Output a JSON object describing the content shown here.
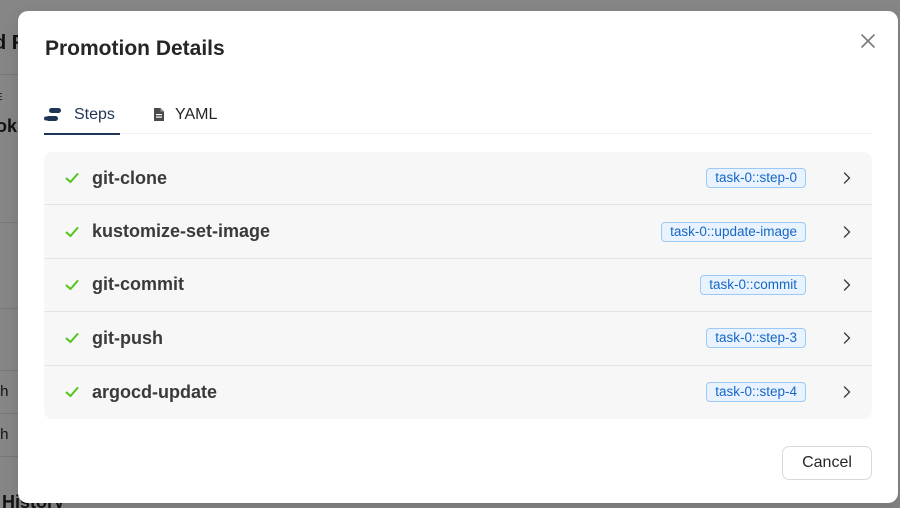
{
  "background": {
    "fragments": [
      "d F",
      "E",
      "ok",
      "th",
      "th",
      "History"
    ]
  },
  "modal": {
    "title": "Promotion Details",
    "close_icon": "close-icon"
  },
  "tabs": [
    {
      "label": "Steps",
      "icon": "steps-icon",
      "active": true
    },
    {
      "label": "YAML",
      "icon": "file-icon",
      "active": false
    }
  ],
  "steps": [
    {
      "name": "git-clone",
      "alias": "task-0::step-0",
      "status": "success"
    },
    {
      "name": "kustomize-set-image",
      "alias": "task-0::update-image",
      "status": "success"
    },
    {
      "name": "git-commit",
      "alias": "task-0::commit",
      "status": "success"
    },
    {
      "name": "git-push",
      "alias": "task-0::step-3",
      "status": "success"
    },
    {
      "name": "argocd-update",
      "alias": "task-0::step-4",
      "status": "success"
    }
  ],
  "footer": {
    "cancel_label": "Cancel"
  },
  "colors": {
    "accent": "#1f3556",
    "success": "#52c41a",
    "tag_text": "#1766c6",
    "tag_bg": "#e8f3ff",
    "tag_border": "#9cc9f5"
  }
}
